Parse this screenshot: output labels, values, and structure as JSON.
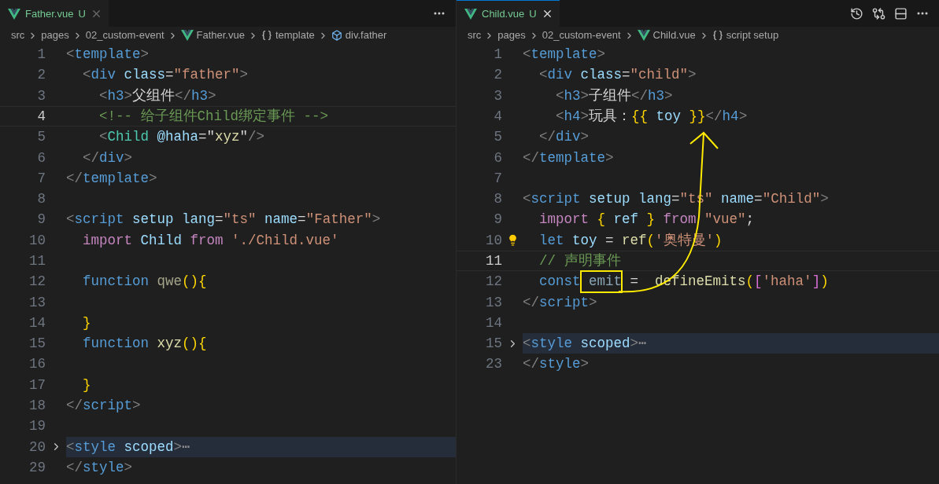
{
  "panes": [
    {
      "tab": {
        "label": "Father.vue",
        "status": "U",
        "selected": false
      },
      "breadcrumbs": [
        {
          "text": "src",
          "kind": "folder"
        },
        {
          "text": "pages",
          "kind": "folder"
        },
        {
          "text": "02_custom-event",
          "kind": "folder"
        },
        {
          "text": "Father.vue",
          "kind": "file"
        },
        {
          "text": "template",
          "kind": "symbol"
        },
        {
          "text": "div.father",
          "kind": "element"
        }
      ],
      "lines": [
        {
          "number": "1",
          "tokens": [
            {
              "kind": "punct",
              "text": "<"
            },
            {
              "kind": "tag",
              "text": "template"
            },
            {
              "kind": "punct",
              "text": ">"
            }
          ]
        },
        {
          "number": "2",
          "tokens": [
            {
              "kind": "punct",
              "text": "  <"
            },
            {
              "kind": "tag",
              "text": "div"
            },
            {
              "kind": "attr",
              "text": " class"
            },
            {
              "kind": "plain",
              "text": "="
            },
            {
              "kind": "string",
              "text": "\"father\""
            },
            {
              "kind": "punct",
              "text": ">"
            }
          ]
        },
        {
          "number": "3",
          "tokens": [
            {
              "kind": "punct",
              "text": "    <"
            },
            {
              "kind": "tag",
              "text": "h3"
            },
            {
              "kind": "punct",
              "text": ">"
            },
            {
              "kind": "plain",
              "text": "父组件"
            },
            {
              "kind": "punct",
              "text": "</"
            },
            {
              "kind": "tag",
              "text": "h3"
            },
            {
              "kind": "punct",
              "text": ">"
            }
          ]
        },
        {
          "number": "4",
          "current": true,
          "tokens": [
            {
              "kind": "comment",
              "text": "    <!-- 给子组件Child绑定事件 -->"
            }
          ]
        },
        {
          "number": "5",
          "tokens": [
            {
              "kind": "punct",
              "text": "    <"
            },
            {
              "kind": "component",
              "text": "Child"
            },
            {
              "kind": "attr",
              "text": " @haha"
            },
            {
              "kind": "plain",
              "text": "=\""
            },
            {
              "kind": "func",
              "text": "xyz"
            },
            {
              "kind": "plain",
              "text": "\""
            },
            {
              "kind": "punct",
              "text": "/>"
            }
          ]
        },
        {
          "number": "6",
          "tokens": [
            {
              "kind": "punct",
              "text": "  </"
            },
            {
              "kind": "tag",
              "text": "div"
            },
            {
              "kind": "punct",
              "text": ">"
            }
          ]
        },
        {
          "number": "7",
          "tokens": [
            {
              "kind": "punct",
              "text": "</"
            },
            {
              "kind": "tag",
              "text": "template"
            },
            {
              "kind": "punct",
              "text": ">"
            }
          ]
        },
        {
          "number": "8"
        },
        {
          "number": "9",
          "tokens": [
            {
              "kind": "punct",
              "text": "<"
            },
            {
              "kind": "tag",
              "text": "script"
            },
            {
              "kind": "attr",
              "text": " setup"
            },
            {
              "kind": "attr",
              "text": " lang"
            },
            {
              "kind": "plain",
              "text": "="
            },
            {
              "kind": "string",
              "text": "\"ts\""
            },
            {
              "kind": "attr",
              "text": " name"
            },
            {
              "kind": "plain",
              "text": "="
            },
            {
              "kind": "string",
              "text": "\"Father\""
            },
            {
              "kind": "punct",
              "text": ">"
            }
          ]
        },
        {
          "number": "10",
          "tokens": [
            {
              "kind": "keyword",
              "text": "  import"
            },
            {
              "kind": "variable",
              "text": " Child"
            },
            {
              "kind": "keyword",
              "text": " from"
            },
            {
              "kind": "string",
              "text": " './Child.vue'"
            }
          ]
        },
        {
          "number": "11"
        },
        {
          "number": "12",
          "tokens": [
            {
              "kind": "storage",
              "text": "  function"
            },
            {
              "kind": "unused-func",
              "text": " qwe"
            },
            {
              "kind": "brace",
              "text": "(){"
            }
          ]
        },
        {
          "number": "13"
        },
        {
          "number": "14",
          "tokens": [
            {
              "kind": "brace",
              "text": "  }"
            }
          ]
        },
        {
          "number": "15",
          "tokens": [
            {
              "kind": "storage",
              "text": "  function"
            },
            {
              "kind": "func",
              "text": " xyz"
            },
            {
              "kind": "brace",
              "text": "(){"
            }
          ]
        },
        {
          "number": "16"
        },
        {
          "number": "17",
          "tokens": [
            {
              "kind": "brace",
              "text": "  }"
            }
          ]
        },
        {
          "number": "18",
          "tokens": [
            {
              "kind": "punct",
              "text": "</"
            },
            {
              "kind": "tag",
              "text": "script"
            },
            {
              "kind": "punct",
              "text": ">"
            }
          ]
        },
        {
          "number": "19"
        },
        {
          "number": "20",
          "folded": true,
          "tokens": [
            {
              "kind": "punct",
              "text": "<"
            },
            {
              "kind": "tag",
              "text": "style"
            },
            {
              "kind": "attr",
              "text": " scoped"
            },
            {
              "kind": "punct",
              "text": ">"
            },
            {
              "kind": "fold",
              "text": "⋯"
            }
          ]
        },
        {
          "number": "29",
          "tokens": [
            {
              "kind": "punct",
              "text": "</"
            },
            {
              "kind": "tag",
              "text": "style"
            },
            {
              "kind": "punct",
              "text": ">"
            }
          ]
        }
      ]
    },
    {
      "tab": {
        "label": "Child.vue",
        "status": "U",
        "selected": true
      },
      "breadcrumbs": [
        {
          "text": "src",
          "kind": "folder"
        },
        {
          "text": "pages",
          "kind": "folder"
        },
        {
          "text": "02_custom-event",
          "kind": "folder"
        },
        {
          "text": "Child.vue",
          "kind": "file"
        },
        {
          "text": "script setup",
          "kind": "symbol"
        }
      ],
      "lines": [
        {
          "number": "1",
          "tokens": [
            {
              "kind": "punct",
              "text": "<"
            },
            {
              "kind": "tag",
              "text": "template"
            },
            {
              "kind": "punct",
              "text": ">"
            }
          ]
        },
        {
          "number": "2",
          "tokens": [
            {
              "kind": "punct",
              "text": "  <"
            },
            {
              "kind": "tag",
              "text": "div"
            },
            {
              "kind": "attr",
              "text": " class"
            },
            {
              "kind": "plain",
              "text": "="
            },
            {
              "kind": "string",
              "text": "\"child\""
            },
            {
              "kind": "punct",
              "text": ">"
            }
          ]
        },
        {
          "number": "3",
          "tokens": [
            {
              "kind": "punct",
              "text": "    <"
            },
            {
              "kind": "tag",
              "text": "h3"
            },
            {
              "kind": "punct",
              "text": ">"
            },
            {
              "kind": "plain",
              "text": "子组件"
            },
            {
              "kind": "punct",
              "text": "</"
            },
            {
              "kind": "tag",
              "text": "h3"
            },
            {
              "kind": "punct",
              "text": ">"
            }
          ]
        },
        {
          "number": "4",
          "tokens": [
            {
              "kind": "punct",
              "text": "    <"
            },
            {
              "kind": "tag",
              "text": "h4"
            },
            {
              "kind": "punct",
              "text": ">"
            },
            {
              "kind": "plain",
              "text": "玩具："
            },
            {
              "kind": "brace",
              "text": "{{"
            },
            {
              "kind": "variable",
              "text": " toy"
            },
            {
              "kind": "brace",
              "text": " }}"
            },
            {
              "kind": "punct",
              "text": "</"
            },
            {
              "kind": "tag",
              "text": "h4"
            },
            {
              "kind": "punct",
              "text": ">"
            }
          ]
        },
        {
          "number": "5",
          "tokens": [
            {
              "kind": "punct",
              "text": "  </"
            },
            {
              "kind": "tag",
              "text": "div"
            },
            {
              "kind": "punct",
              "text": ">"
            }
          ]
        },
        {
          "number": "6",
          "tokens": [
            {
              "kind": "punct",
              "text": "</"
            },
            {
              "kind": "tag",
              "text": "template"
            },
            {
              "kind": "punct",
              "text": ">"
            }
          ]
        },
        {
          "number": "7"
        },
        {
          "number": "8",
          "tokens": [
            {
              "kind": "punct",
              "text": "<"
            },
            {
              "kind": "tag",
              "text": "script"
            },
            {
              "kind": "attr",
              "text": " setup"
            },
            {
              "kind": "attr",
              "text": " lang"
            },
            {
              "kind": "plain",
              "text": "="
            },
            {
              "kind": "string",
              "text": "\"ts\""
            },
            {
              "kind": "attr",
              "text": " name"
            },
            {
              "kind": "plain",
              "text": "="
            },
            {
              "kind": "string",
              "text": "\"Child\""
            },
            {
              "kind": "punct",
              "text": ">"
            }
          ]
        },
        {
          "number": "9",
          "tokens": [
            {
              "kind": "keyword",
              "text": "  import"
            },
            {
              "kind": "brace",
              "text": " {"
            },
            {
              "kind": "variable",
              "text": " ref"
            },
            {
              "kind": "brace",
              "text": " }"
            },
            {
              "kind": "keyword",
              "text": " from"
            },
            {
              "kind": "string",
              "text": " \"vue\""
            },
            {
              "kind": "plain",
              "text": ";"
            }
          ]
        },
        {
          "number": "10",
          "lightbulb": true,
          "tokens": [
            {
              "kind": "storage",
              "text": "  let"
            },
            {
              "kind": "variable",
              "text": " toy"
            },
            {
              "kind": "plain",
              "text": " = "
            },
            {
              "kind": "func",
              "text": "ref"
            },
            {
              "kind": "brace",
              "text": "("
            },
            {
              "kind": "string",
              "text": "'奥特曼'"
            },
            {
              "kind": "brace",
              "text": ")"
            }
          ]
        },
        {
          "number": "11",
          "current": true,
          "tokens": [
            {
              "kind": "comment",
              "text": "  // 声明事件"
            }
          ]
        },
        {
          "number": "12",
          "tokens": [
            {
              "kind": "storage",
              "text": "  const"
            },
            {
              "kind": "unused-var",
              "text": " emit"
            },
            {
              "kind": "plain",
              "text": " =  "
            },
            {
              "kind": "func",
              "text": "defineEmits"
            },
            {
              "kind": "brace",
              "text": "("
            },
            {
              "kind": "brace2",
              "text": "["
            },
            {
              "kind": "string",
              "text": "'haha'"
            },
            {
              "kind": "brace2",
              "text": "]"
            },
            {
              "kind": "brace",
              "text": ")"
            }
          ]
        },
        {
          "number": "13",
          "tokens": [
            {
              "kind": "punct",
              "text": "</"
            },
            {
              "kind": "tag",
              "text": "script"
            },
            {
              "kind": "punct",
              "text": ">"
            }
          ]
        },
        {
          "number": "14"
        },
        {
          "number": "15",
          "folded": true,
          "tokens": [
            {
              "kind": "punct",
              "text": "<"
            },
            {
              "kind": "tag",
              "text": "style"
            },
            {
              "kind": "attr",
              "text": " scoped"
            },
            {
              "kind": "punct",
              "text": ">"
            },
            {
              "kind": "fold",
              "text": "⋯"
            }
          ]
        },
        {
          "number": "23",
          "tokens": [
            {
              "kind": "punct",
              "text": "</"
            },
            {
              "kind": "tag",
              "text": "style"
            },
            {
              "kind": "punct",
              "text": ">"
            }
          ]
        }
      ]
    }
  ]
}
